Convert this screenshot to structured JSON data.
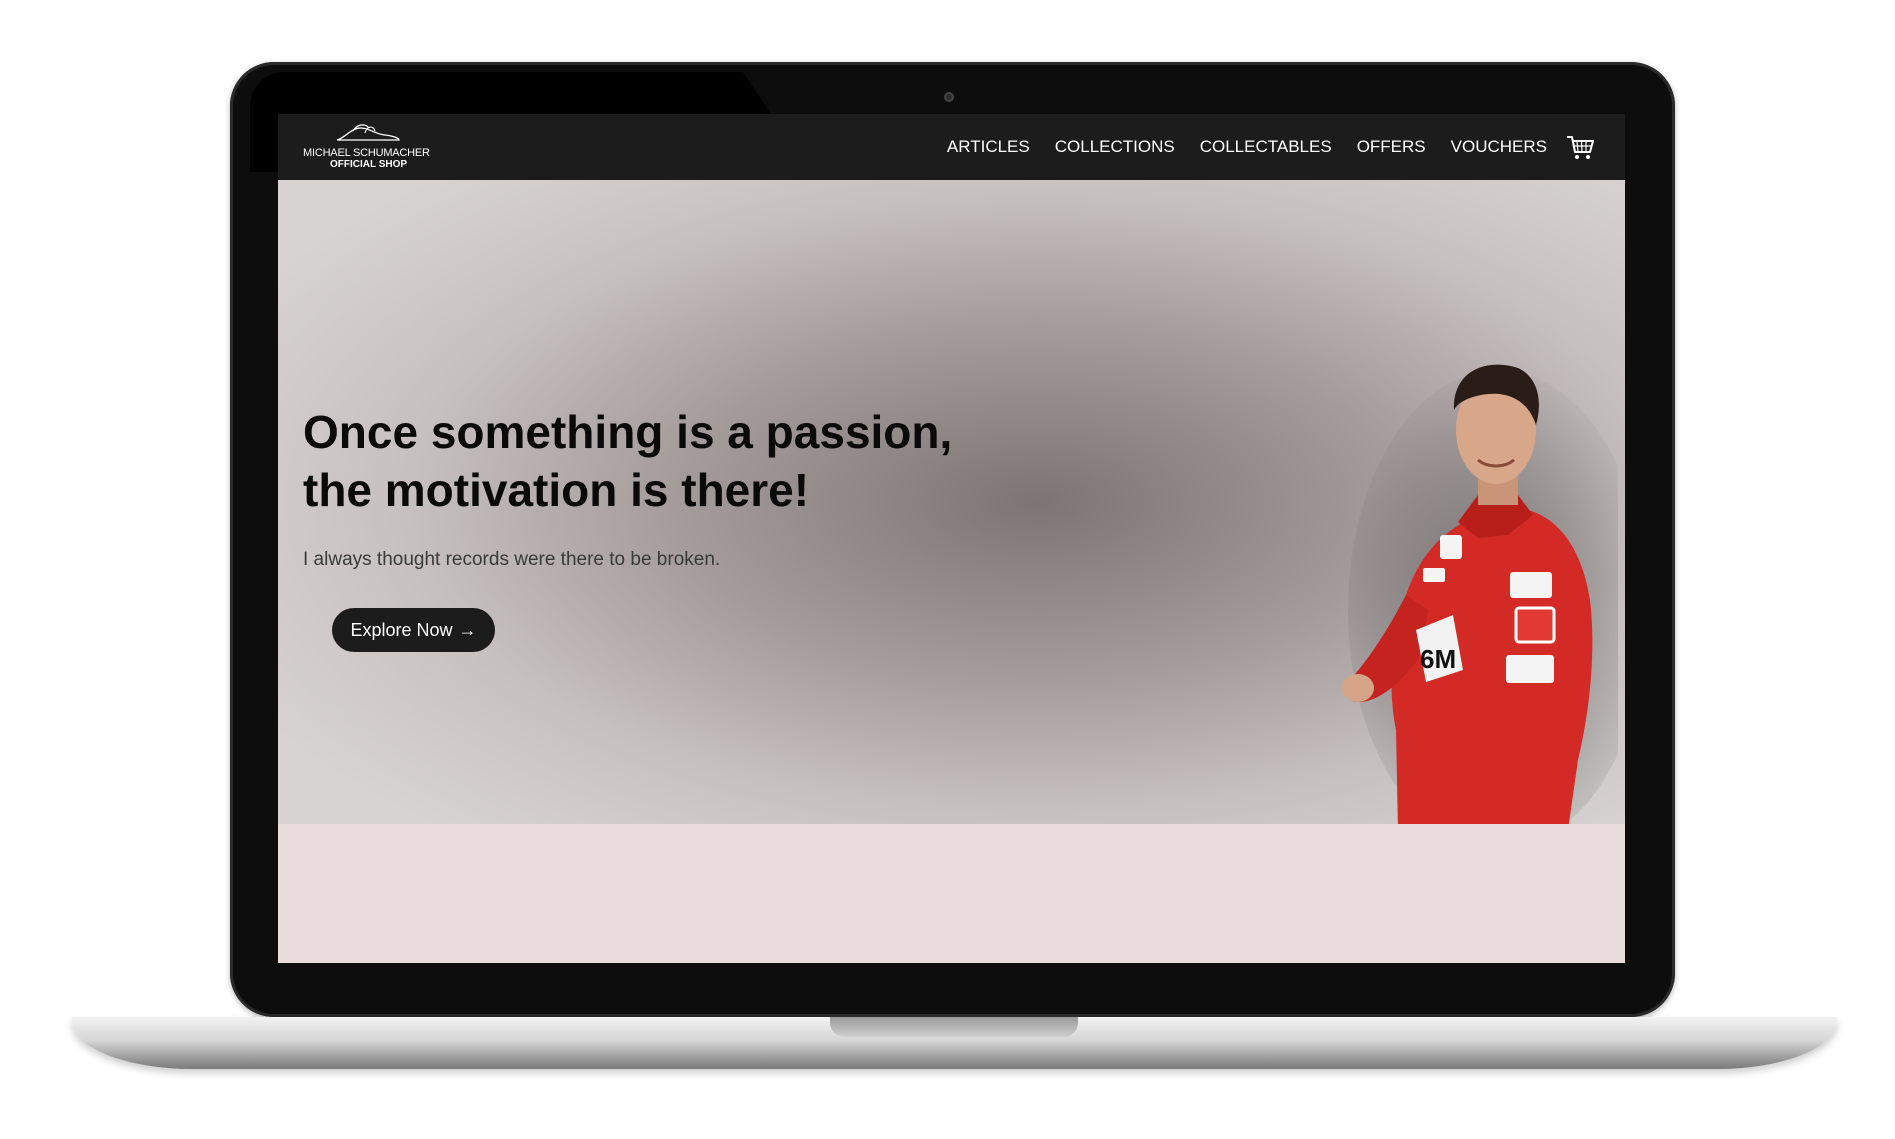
{
  "logo": {
    "line1": "MICHAEL SCHUMACHER",
    "line2": "OFFICIAL SHOP"
  },
  "nav": {
    "items": [
      {
        "label": "ARTICLES"
      },
      {
        "label": "COLLECTIONS"
      },
      {
        "label": "COLLECTABLES"
      },
      {
        "label": "OFFERS"
      },
      {
        "label": "VOUCHERS"
      }
    ],
    "cart_icon": "shopping-cart-icon"
  },
  "hero": {
    "headline_line1": "Once something is a passion,",
    "headline_line2": "the motivation is there!",
    "subtext": "I always thought records were there to be broken.",
    "cta_label": "Explore Now",
    "cta_arrow": "→"
  },
  "colors": {
    "navbar_bg": "#1c1c1c",
    "hero_center": "#7d7474",
    "hero_edge": "#d8d3d3",
    "below_hero": "#ebdddd",
    "suit_red": "#d42a25",
    "button_bg": "#1c1c1c"
  }
}
